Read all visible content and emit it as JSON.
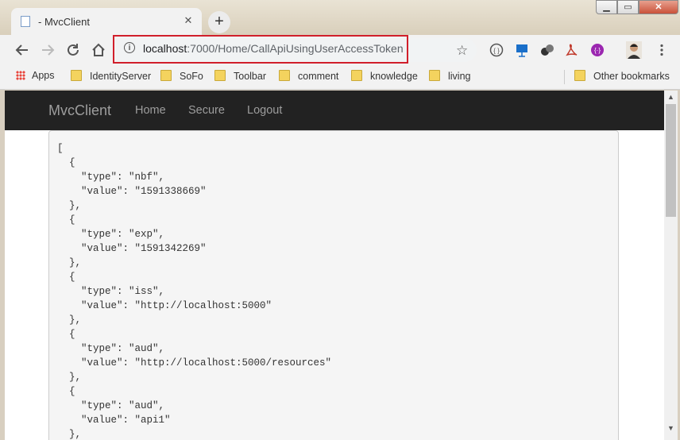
{
  "browser": {
    "tab_title": "- MvcClient",
    "tab_close": "✕",
    "new_tab": "+",
    "url_host": "localhost",
    "url_path": ":7000/Home/CallApiUsingUserAccessToken",
    "window_controls": {
      "minimize": "▁",
      "maximize": "▭",
      "close": "✕"
    }
  },
  "bookmarks": [
    {
      "label": "Apps",
      "icon": "apps-grid-icon"
    },
    {
      "label": "IdentityServer",
      "icon": "folder-icon"
    },
    {
      "label": "SoFo",
      "icon": "folder-icon"
    },
    {
      "label": "Toolbar",
      "icon": "folder-icon"
    },
    {
      "label": "comment",
      "icon": "folder-icon"
    },
    {
      "label": "knowledge",
      "icon": "folder-icon"
    },
    {
      "label": "living",
      "icon": "folder-icon"
    },
    {
      "label": "Other bookmarks",
      "icon": "folder-icon"
    }
  ],
  "app": {
    "brand": "MvcClient",
    "nav": [
      "Home",
      "Secure",
      "Logout"
    ]
  },
  "json_output": "[\n  {\n    \"type\": \"nbf\",\n    \"value\": \"1591338669\"\n  },\n  {\n    \"type\": \"exp\",\n    \"value\": \"1591342269\"\n  },\n  {\n    \"type\": \"iss\",\n    \"value\": \"http://localhost:5000\"\n  },\n  {\n    \"type\": \"aud\",\n    \"value\": \"http://localhost:5000/resources\"\n  },\n  {\n    \"type\": \"aud\",\n    \"value\": \"api1\"\n  },",
  "colors": {
    "navbar": "#222222",
    "highlight": "#d11f2b",
    "nav_text": "#9d9d9d"
  }
}
